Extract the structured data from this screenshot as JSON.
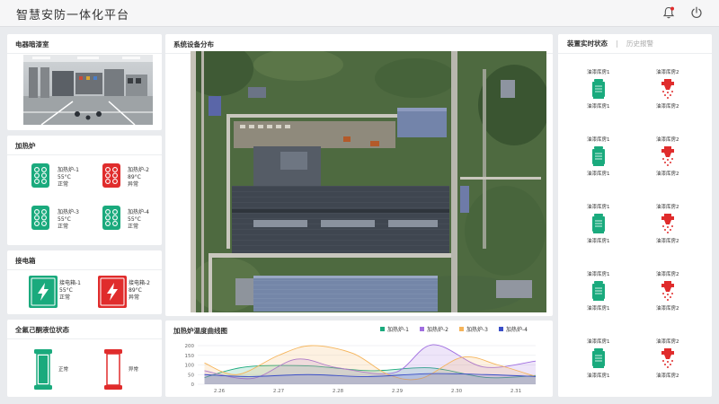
{
  "app": {
    "title": "智慧安防一体化平台"
  },
  "header": {
    "alarm_icon": "bell-alert-icon",
    "power_icon": "power-icon"
  },
  "room_panel": {
    "title": "电器暗漆室"
  },
  "heater_panel": {
    "title": "加热炉",
    "items": [
      {
        "name": "加热炉-1",
        "temp": "55°C",
        "status": "正常",
        "color": "#1aaa7d"
      },
      {
        "name": "加热炉-2",
        "temp": "89°C",
        "status": "异常",
        "color": "#e02c2c"
      },
      {
        "name": "加热炉-3",
        "temp": "55°C",
        "status": "正常",
        "color": "#1aaa7d"
      },
      {
        "name": "加热炉-4",
        "temp": "55°C",
        "status": "正常",
        "color": "#1aaa7d"
      }
    ]
  },
  "box_panel": {
    "title": "接电箱",
    "items": [
      {
        "name": "接电箱-1",
        "temp": "55°C",
        "status": "正常",
        "color": "#1aaa7d"
      },
      {
        "name": "接电箱-2",
        "temp": "89°C",
        "status": "异常",
        "color": "#e02c2c"
      }
    ]
  },
  "level_panel": {
    "title": "全氟己酮液位状态",
    "items": [
      {
        "status": "正常",
        "color": "#1aaa7d",
        "level": 1.0
      },
      {
        "status": "异常",
        "color": "#e02c2c",
        "level": 0.0
      }
    ]
  },
  "map_panel": {
    "title": "系统设备分布"
  },
  "chart_panel": {
    "title": "加热炉温度曲线图"
  },
  "chart_data": {
    "type": "area",
    "title": "加热炉温度曲线图",
    "categories": [
      "2.26",
      "2.27",
      "2.28",
      "2.29",
      "2.30",
      "2.31"
    ],
    "x": [
      0,
      1,
      2,
      3,
      4,
      5
    ],
    "ylim": [
      0,
      200
    ],
    "yticks": [
      0,
      50,
      100,
      150,
      200
    ],
    "legend_position": "top-right",
    "grid": true,
    "series": [
      {
        "name": "加热炉-1",
        "color": "#1aaa7d",
        "points": [
          [
            -0.25,
            35
          ],
          [
            0.45,
            90
          ],
          [
            1.5,
            95
          ],
          [
            2.55,
            70
          ],
          [
            3.55,
            85
          ],
          [
            4.5,
            35
          ],
          [
            5.35,
            45
          ]
        ]
      },
      {
        "name": "加热炉-2",
        "color": "#a06ee0",
        "points": [
          [
            -0.25,
            70
          ],
          [
            0.55,
            30
          ],
          [
            1.3,
            130
          ],
          [
            2.0,
            85
          ],
          [
            2.95,
            60
          ],
          [
            3.6,
            205
          ],
          [
            4.45,
            90
          ],
          [
            5.35,
            120
          ]
        ]
      },
      {
        "name": "加热炉-3",
        "color": "#f5b45a",
        "points": [
          [
            -0.25,
            110
          ],
          [
            0.3,
            50
          ],
          [
            1.0,
            150
          ],
          [
            1.55,
            200
          ],
          [
            2.25,
            160
          ],
          [
            2.85,
            50
          ],
          [
            3.4,
            30
          ],
          [
            4.1,
            140
          ],
          [
            4.7,
            100
          ],
          [
            5.35,
            40
          ]
        ]
      },
      {
        "name": "加热炉-4",
        "color": "#3b4fc8",
        "points": [
          [
            -0.25,
            50
          ],
          [
            0.5,
            40
          ],
          [
            1.5,
            50
          ],
          [
            2.5,
            40
          ],
          [
            3.55,
            55
          ],
          [
            4.5,
            50
          ],
          [
            5.35,
            40
          ]
        ]
      }
    ]
  },
  "status_panel": {
    "tab_active": "装置实时状态",
    "tab_inactive": "历史报警",
    "rows": [
      {
        "left": {
          "label": "油漆库房1",
          "color": "#1aaa7d",
          "state": "normal"
        },
        "right": {
          "label": "油漆库房2",
          "color": "#e02c2c",
          "state": "alarm"
        }
      },
      {
        "left": {
          "label": "油漆库房1",
          "color": "#1aaa7d",
          "state": "normal"
        },
        "right": {
          "label": "油漆库房2",
          "color": "#e02c2c",
          "state": "alarm"
        }
      },
      {
        "left": {
          "label": "油漆库房1",
          "color": "#1aaa7d",
          "state": "normal"
        },
        "right": {
          "label": "油漆库房2",
          "color": "#e02c2c",
          "state": "alarm"
        }
      },
      {
        "left": {
          "label": "油漆库房1",
          "color": "#1aaa7d",
          "state": "normal"
        },
        "right": {
          "label": "油漆库房2",
          "color": "#e02c2c",
          "state": "alarm"
        }
      },
      {
        "left": {
          "label": "油漆库房1",
          "color": "#1aaa7d",
          "state": "normal"
        },
        "right": {
          "label": "油漆库房2",
          "color": "#e02c2c",
          "state": "alarm"
        }
      }
    ]
  }
}
